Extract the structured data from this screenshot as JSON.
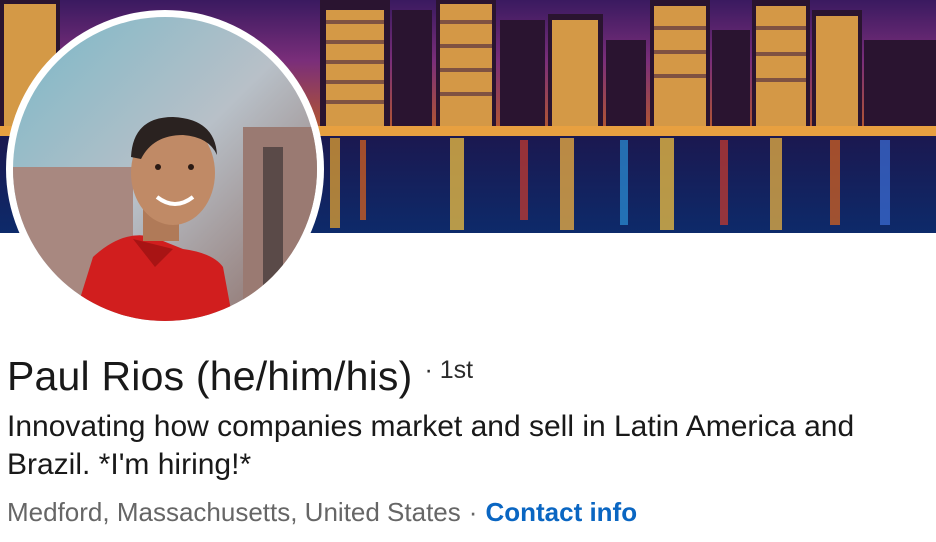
{
  "profile": {
    "name": "Paul Rios (he/him/his)",
    "connection_degree": "· 1st",
    "headline": "Innovating how companies market and sell in Latin America and Brazil. *I'm hiring!*",
    "location": "Medford, Massachusetts, United States",
    "separator": "·",
    "contact_info_label": "Contact info"
  },
  "colors": {
    "link": "#0a66c2",
    "text_primary": "#191919",
    "text_secondary": "#666666",
    "shirt": "#d11e1e"
  },
  "icons": {
    "banner": "city-skyline-night-image",
    "avatar": "profile-photo"
  }
}
